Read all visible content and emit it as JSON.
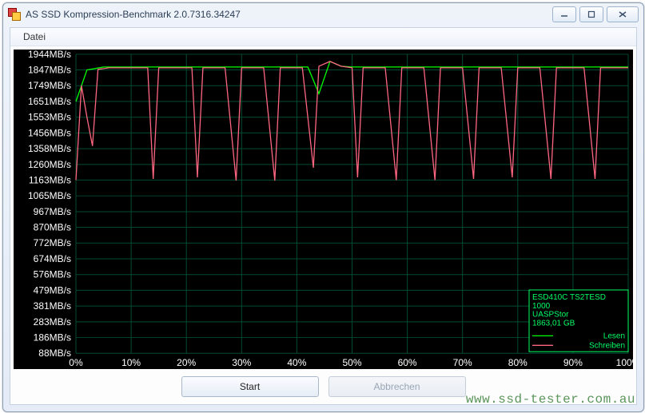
{
  "window": {
    "title": "AS SSD Kompression-Benchmark 2.0.7316.34247"
  },
  "menu": {
    "datei": "Datei"
  },
  "buttons": {
    "start": "Start",
    "cancel": "Abbrechen"
  },
  "watermark": "www.ssd-tester.com.au",
  "device_info": {
    "line1": "ESD410C TS2TESD",
    "line2": "1000",
    "line3": "UASPStor",
    "line4": "1863,01 GB"
  },
  "legend": {
    "read": "Lesen",
    "write": "Schreiben"
  },
  "chart_data": {
    "type": "line",
    "xlabel": "",
    "ylabel": "",
    "x_ticks_pct": [
      0,
      10,
      20,
      30,
      40,
      50,
      60,
      70,
      80,
      90,
      100
    ],
    "y_ticks_mbs": [
      88,
      186,
      283,
      381,
      479,
      576,
      674,
      772,
      870,
      967,
      1065,
      1163,
      1260,
      1358,
      1456,
      1553,
      1651,
      1749,
      1847,
      1944
    ],
    "y_unit": "MB/s",
    "ylim": [
      88,
      1944
    ],
    "xlim": [
      0,
      100
    ],
    "series": [
      {
        "name": "Lesen",
        "color": "#00ff00",
        "points": [
          {
            "x": 0,
            "y": 1651
          },
          {
            "x": 2,
            "y": 1847
          },
          {
            "x": 5,
            "y": 1865
          },
          {
            "x": 10,
            "y": 1865
          },
          {
            "x": 15,
            "y": 1865
          },
          {
            "x": 20,
            "y": 1865
          },
          {
            "x": 25,
            "y": 1865
          },
          {
            "x": 30,
            "y": 1865
          },
          {
            "x": 35,
            "y": 1865
          },
          {
            "x": 40,
            "y": 1865
          },
          {
            "x": 42,
            "y": 1865
          },
          {
            "x": 44,
            "y": 1700
          },
          {
            "x": 46,
            "y": 1900
          },
          {
            "x": 48,
            "y": 1870
          },
          {
            "x": 50,
            "y": 1865
          },
          {
            "x": 55,
            "y": 1865
          },
          {
            "x": 60,
            "y": 1865
          },
          {
            "x": 65,
            "y": 1865
          },
          {
            "x": 70,
            "y": 1865
          },
          {
            "x": 75,
            "y": 1865
          },
          {
            "x": 80,
            "y": 1865
          },
          {
            "x": 85,
            "y": 1865
          },
          {
            "x": 90,
            "y": 1865
          },
          {
            "x": 95,
            "y": 1865
          },
          {
            "x": 100,
            "y": 1865
          }
        ]
      },
      {
        "name": "Schreiben",
        "color": "#ff6680",
        "points": [
          {
            "x": 0,
            "y": 1163
          },
          {
            "x": 1,
            "y": 1750
          },
          {
            "x": 2,
            "y": 1553
          },
          {
            "x": 3,
            "y": 1375
          },
          {
            "x": 4,
            "y": 1850
          },
          {
            "x": 6,
            "y": 1860
          },
          {
            "x": 9,
            "y": 1860
          },
          {
            "x": 11,
            "y": 1860
          },
          {
            "x": 13,
            "y": 1860
          },
          {
            "x": 14,
            "y": 1170
          },
          {
            "x": 15,
            "y": 1860
          },
          {
            "x": 17,
            "y": 1860
          },
          {
            "x": 19,
            "y": 1860
          },
          {
            "x": 21,
            "y": 1860
          },
          {
            "x": 22,
            "y": 1180
          },
          {
            "x": 23,
            "y": 1860
          },
          {
            "x": 25,
            "y": 1860
          },
          {
            "x": 27,
            "y": 1860
          },
          {
            "x": 29,
            "y": 1160
          },
          {
            "x": 30,
            "y": 1860
          },
          {
            "x": 32,
            "y": 1860
          },
          {
            "x": 34,
            "y": 1860
          },
          {
            "x": 36,
            "y": 1160
          },
          {
            "x": 37,
            "y": 1860
          },
          {
            "x": 39,
            "y": 1860
          },
          {
            "x": 41,
            "y": 1860
          },
          {
            "x": 43,
            "y": 1240
          },
          {
            "x": 44,
            "y": 1870
          },
          {
            "x": 46,
            "y": 1900
          },
          {
            "x": 48,
            "y": 1870
          },
          {
            "x": 50,
            "y": 1860
          },
          {
            "x": 51,
            "y": 1180
          },
          {
            "x": 52,
            "y": 1860
          },
          {
            "x": 54,
            "y": 1860
          },
          {
            "x": 56,
            "y": 1860
          },
          {
            "x": 58,
            "y": 1163
          },
          {
            "x": 59,
            "y": 1860
          },
          {
            "x": 61,
            "y": 1860
          },
          {
            "x": 63,
            "y": 1860
          },
          {
            "x": 65,
            "y": 1163
          },
          {
            "x": 66,
            "y": 1860
          },
          {
            "x": 68,
            "y": 1860
          },
          {
            "x": 70,
            "y": 1860
          },
          {
            "x": 72,
            "y": 1170
          },
          {
            "x": 73,
            "y": 1860
          },
          {
            "x": 75,
            "y": 1860
          },
          {
            "x": 77,
            "y": 1860
          },
          {
            "x": 79,
            "y": 1180
          },
          {
            "x": 80,
            "y": 1860
          },
          {
            "x": 82,
            "y": 1860
          },
          {
            "x": 84,
            "y": 1860
          },
          {
            "x": 86,
            "y": 1170
          },
          {
            "x": 87,
            "y": 1860
          },
          {
            "x": 89,
            "y": 1860
          },
          {
            "x": 92,
            "y": 1860
          },
          {
            "x": 94,
            "y": 1170
          },
          {
            "x": 95,
            "y": 1860
          },
          {
            "x": 97,
            "y": 1860
          },
          {
            "x": 99,
            "y": 1860
          },
          {
            "x": 100,
            "y": 1860
          }
        ]
      }
    ]
  }
}
